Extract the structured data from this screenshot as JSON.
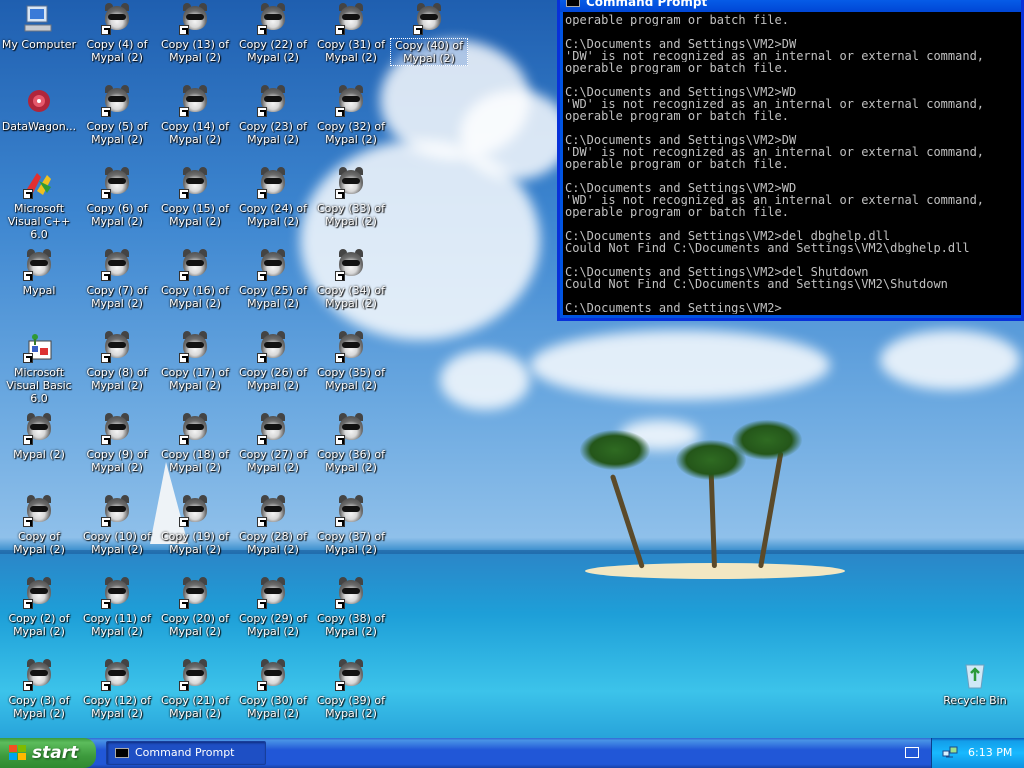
{
  "desktop": {
    "icons": [
      {
        "name": "My Computer",
        "kind": "computer"
      },
      {
        "name": "DataWagon...",
        "kind": "datawagon"
      },
      {
        "name": "Microsoft Visual C++ 6.0",
        "kind": "vcpp"
      },
      {
        "name": "Mypal",
        "kind": "raccoon"
      },
      {
        "name": "Microsoft Visual Basic 6.0",
        "kind": "vb"
      },
      {
        "name": "Mypal (2)",
        "kind": "raccoon"
      },
      {
        "name": "Copy of Mypal (2)",
        "kind": "raccoon"
      },
      {
        "name": "Copy (2) of Mypal (2)",
        "kind": "raccoon"
      },
      {
        "name": "Copy (3) of Mypal (2)",
        "kind": "raccoon"
      },
      {
        "name": "Copy (4) of Mypal (2)",
        "kind": "raccoon"
      },
      {
        "name": "Copy (5) of Mypal (2)",
        "kind": "raccoon"
      },
      {
        "name": "Copy (6) of Mypal (2)",
        "kind": "raccoon"
      },
      {
        "name": "Copy (7) of Mypal (2)",
        "kind": "raccoon"
      },
      {
        "name": "Copy (8) of Mypal (2)",
        "kind": "raccoon"
      },
      {
        "name": "Copy (9) of Mypal (2)",
        "kind": "raccoon"
      },
      {
        "name": "Copy (10) of Mypal (2)",
        "kind": "raccoon"
      },
      {
        "name": "Copy (11) of Mypal (2)",
        "kind": "raccoon"
      },
      {
        "name": "Copy (12) of Mypal (2)",
        "kind": "raccoon"
      },
      {
        "name": "Copy (13) of Mypal (2)",
        "kind": "raccoon"
      },
      {
        "name": "Copy (14) of Mypal (2)",
        "kind": "raccoon"
      },
      {
        "name": "Copy (15) of Mypal (2)",
        "kind": "raccoon"
      },
      {
        "name": "Copy (16) of Mypal (2)",
        "kind": "raccoon"
      },
      {
        "name": "Copy (17) of Mypal (2)",
        "kind": "raccoon"
      },
      {
        "name": "Copy (18) of Mypal (2)",
        "kind": "raccoon"
      },
      {
        "name": "Copy (19) of Mypal (2)",
        "kind": "raccoon"
      },
      {
        "name": "Copy (20) of Mypal (2)",
        "kind": "raccoon"
      },
      {
        "name": "Copy (21) of Mypal (2)",
        "kind": "raccoon"
      },
      {
        "name": "Copy (22) of Mypal (2)",
        "kind": "raccoon"
      },
      {
        "name": "Copy (23) of Mypal (2)",
        "kind": "raccoon"
      },
      {
        "name": "Copy (24) of Mypal (2)",
        "kind": "raccoon"
      },
      {
        "name": "Copy (25) of Mypal (2)",
        "kind": "raccoon"
      },
      {
        "name": "Copy (26) of Mypal (2)",
        "kind": "raccoon"
      },
      {
        "name": "Copy (27) of Mypal (2)",
        "kind": "raccoon"
      },
      {
        "name": "Copy (28) of Mypal (2)",
        "kind": "raccoon"
      },
      {
        "name": "Copy (29) of Mypal (2)",
        "kind": "raccoon"
      },
      {
        "name": "Copy (30) of Mypal (2)",
        "kind": "raccoon"
      },
      {
        "name": "Copy (31) of Mypal (2)",
        "kind": "raccoon"
      },
      {
        "name": "Copy (32) of Mypal (2)",
        "kind": "raccoon"
      },
      {
        "name": "Copy (33) of Mypal (2)",
        "kind": "raccoon"
      },
      {
        "name": "Copy (34) of Mypal (2)",
        "kind": "raccoon"
      },
      {
        "name": "Copy (35) of Mypal (2)",
        "kind": "raccoon"
      },
      {
        "name": "Copy (36) of Mypal (2)",
        "kind": "raccoon"
      },
      {
        "name": "Copy (37) of Mypal (2)",
        "kind": "raccoon"
      },
      {
        "name": "Copy (38) of Mypal (2)",
        "kind": "raccoon"
      },
      {
        "name": "Copy (39) of Mypal (2)",
        "kind": "raccoon"
      },
      {
        "name": "Copy (40) of Mypal (2)",
        "kind": "raccoon",
        "selected": true
      },
      {
        "name": "Recycle Bin",
        "kind": "recycle-bin"
      }
    ]
  },
  "command_prompt": {
    "title": "Command Prompt",
    "lines": [
      "operable program or batch file.",
      "",
      "C:\\Documents and Settings\\VM2>DW",
      "'DW' is not recognized as an internal or external command,",
      "operable program or batch file.",
      "",
      "C:\\Documents and Settings\\VM2>WD",
      "'WD' is not recognized as an internal or external command,",
      "operable program or batch file.",
      "",
      "C:\\Documents and Settings\\VM2>DW",
      "'DW' is not recognized as an internal or external command,",
      "operable program or batch file.",
      "",
      "C:\\Documents and Settings\\VM2>WD",
      "'WD' is not recognized as an internal or external command,",
      "operable program or batch file.",
      "",
      "C:\\Documents and Settings\\VM2>del dbghelp.dll",
      "Could Not Find C:\\Documents and Settings\\VM2\\dbghelp.dll",
      "",
      "C:\\Documents and Settings\\VM2>del Shutdown",
      "Could Not Find C:\\Documents and Settings\\VM2\\Shutdown",
      "",
      "C:\\Documents and Settings\\VM2>"
    ]
  },
  "taskbar": {
    "start_label": "start",
    "tasks": [
      {
        "label": "Command Prompt",
        "icon": "console-icon"
      }
    ],
    "clock": "6:13 PM"
  },
  "colors": {
    "taskbar_blue": "#2157d7",
    "start_green": "#3d9a3d",
    "tray_blue": "#18b9ff",
    "console_text": "#c0c0c0"
  }
}
